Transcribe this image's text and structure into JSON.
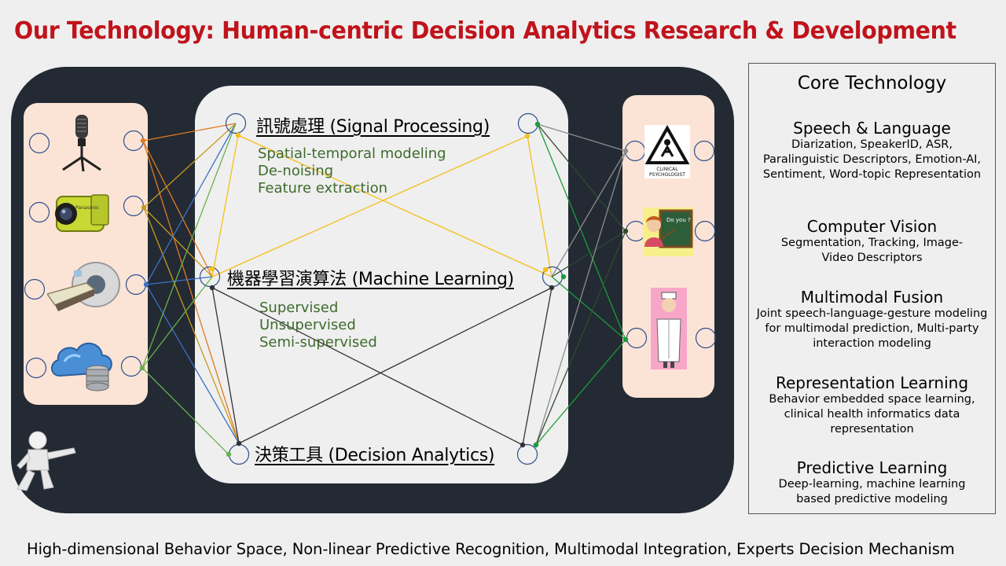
{
  "title": "Our Technology: Human-centric Decision Analytics Research & Development",
  "nodes": {
    "signal": {
      "title": "訊號處理 (Signal Processing)",
      "items": [
        "Spatial-temporal modeling",
        "De-noising",
        "Feature extraction"
      ]
    },
    "ml": {
      "title": "機器學習演算法 (Machine Learning)",
      "items": [
        "Supervised",
        "Unsupervised",
        "Semi-supervised"
      ]
    },
    "decision": {
      "title": "決策工具 (Decision Analytics)"
    }
  },
  "inputs": [
    "microphone-icon",
    "camcorder-icon",
    "mri-scanner-icon",
    "cloud-database-icon"
  ],
  "experts": {
    "psychologist_label": "CLINICAL PSYCHOLOGIST",
    "teacher_bubble": "Do you ?",
    "icons": [
      "clinical-psychologist-icon",
      "teacher-icon",
      "doctor-icon"
    ]
  },
  "core": {
    "title": "Core Technology",
    "sections": [
      {
        "heading": "Speech & Language",
        "desc": "Diarization, SpeakerID, ASR, Paralinguistic Descriptors, Emotion-AI, Sentiment, Word-topic Representation"
      },
      {
        "heading": "Computer Vision",
        "desc": "Segmentation, Tracking, Image-Video Descriptors"
      },
      {
        "heading": "Multimodal Fusion",
        "desc": "Joint speech-language-gesture modeling for multimodal prediction, Multi-party interaction modeling"
      },
      {
        "heading": "Representation Learning",
        "desc": "Behavior embedded space learning, clinical health informatics data representation"
      },
      {
        "heading": "Predictive Learning",
        "desc": "Deep-learning, machine learning based predictive modeling"
      }
    ]
  },
  "footer": "High-dimensional Behavior Space, Non-linear Predictive Recognition, Multimodal Integration, Experts Decision Mechanism",
  "colors": {
    "title": "#c0131b",
    "dark_panel": "#232a33",
    "peach_panel": "#fbe4d6",
    "subtext": "#3e6b2c",
    "link_orange": "#e07b22",
    "link_yellow": "#f5c018",
    "link_blue": "#3d6fc4",
    "link_green": "#6ab04c",
    "link_darkgreen": "#1b9c3a",
    "link_black": "#333333",
    "link_gray": "#8c8c8c"
  }
}
